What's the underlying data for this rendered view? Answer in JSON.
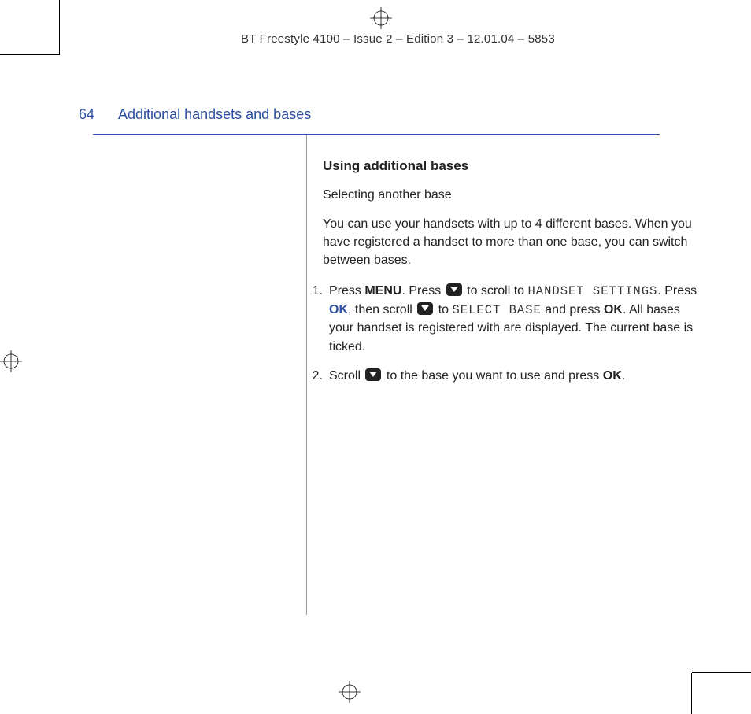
{
  "header": "BT Freestyle 4100 – Issue 2 – Edition 3 – 12.01.04 – 5853",
  "page_number": "64",
  "section_title": "Additional handsets and bases",
  "body": {
    "heading": "Using additional bases",
    "subheading": "Selecting another base",
    "intro": "You can use your handsets with up to 4 different bases. When you have registered a handset to more than one base, you can switch between bases.",
    "steps": [
      {
        "num": "1",
        "press": "Press ",
        "menu": "MENU",
        "press2": ". Press ",
        "scroll_to": " to scroll to ",
        "hs_settings": "HANDSET SETTINGS",
        "period1": ". Press ",
        "ok1": "OK",
        "then_scroll": ", then scroll ",
        "to2": " to ",
        "select_base": "SELECT BASE",
        "and_press": " and press ",
        "ok2": "OK",
        "rest": ". All bases your handset is registered with are displayed. The current base is ticked."
      },
      {
        "num": "2",
        "scroll": "Scroll ",
        "to_base": " to the base you want to use and press ",
        "ok": "OK",
        "end": "."
      }
    ]
  }
}
